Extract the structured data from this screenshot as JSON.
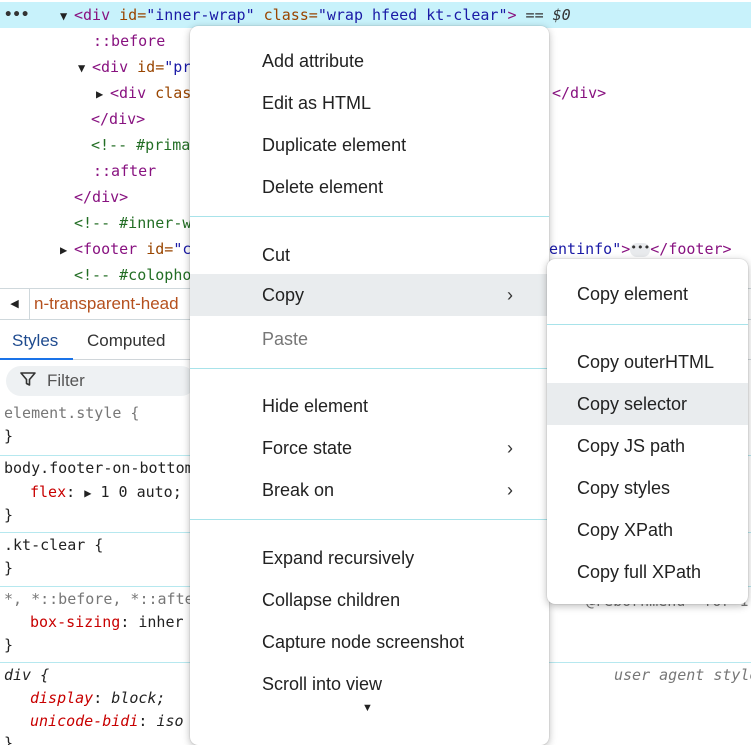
{
  "dom_tree": {
    "overflow_dots": "•••",
    "lines": [
      {
        "tri": "▼",
        "open": "<div",
        "attr1": " id=",
        "val1": "\"inner-wrap\"",
        "attr2": " class=",
        "val2": "\"wrap hfeed kt-clear\"",
        "close": ">",
        "eq": " == $0"
      },
      {
        "pseudo": "::before"
      },
      {
        "tri": "▼",
        "open": "<div",
        "attr1": " id=",
        "val1": "\"pr"
      },
      {
        "tri": "▶",
        "open": "<div",
        "attr1": " clas",
        "tail": "</div>"
      },
      {
        "tag": "</div>"
      },
      {
        "comment": "<!-- #prima"
      },
      {
        "pseudo": "::after"
      },
      {
        "tag": "</div>"
      },
      {
        "comment": "<!-- #inner-w"
      },
      {
        "tri": "▶",
        "open": "<footer",
        "attr1": " id=",
        "val1": "\"c",
        "tail_val": "entinfo\"",
        "tail_close": ">",
        "pill": "•••",
        "tail_tag": "</footer>"
      },
      {
        "comment": "<!-- #colopho"
      }
    ]
  },
  "breadcrumb": {
    "left_arrow": "◀",
    "text": "n-transparent-head"
  },
  "styles_pane": {
    "tabs": [
      {
        "label": "Styles"
      },
      {
        "label": "Computed"
      }
    ],
    "filter_placeholder": "Filter",
    "rules": {
      "element_style": "element.style {",
      "close1": "}",
      "body_selector": "body.footer-on-bottom",
      "flex_prop": "flex",
      "flex_val": "1 0 auto;",
      "close2": "}",
      "kt_clear": ".kt-clear {",
      "close3": "}",
      "universal": "*, *::before, *::afte",
      "box_sizing_prop": "box-sizing",
      "box_sizing_val": "inher",
      "close4": "}",
      "div_selector": "div {",
      "ua_note": "user agent style",
      "display_prop": "display",
      "display_val": "block;",
      "unicode_prop": "unicode-bidi",
      "unicode_val": "iso",
      "close5": "}",
      "snippet_behind_submenu": "@rebornmenu- for 1"
    }
  },
  "context_menu": {
    "items": [
      {
        "label": "Add attribute"
      },
      {
        "label": "Edit as HTML"
      },
      {
        "label": "Duplicate element"
      },
      {
        "label": "Delete element"
      },
      {
        "label": "Cut"
      },
      {
        "label": "Copy",
        "submenu": true,
        "highlighted": true
      },
      {
        "label": "Paste",
        "disabled": true
      },
      {
        "label": "Hide element"
      },
      {
        "label": "Force state",
        "submenu": true
      },
      {
        "label": "Break on",
        "submenu": true
      },
      {
        "label": "Expand recursively"
      },
      {
        "label": "Collapse children"
      },
      {
        "label": "Capture node screenshot"
      },
      {
        "label": "Scroll into view"
      }
    ],
    "submenu_arrow": "›",
    "more_indicator": "▼"
  },
  "copy_submenu": {
    "items": [
      {
        "label": "Copy element"
      },
      {
        "label": "Copy outerHTML"
      },
      {
        "label": "Copy selector",
        "highlighted": true
      },
      {
        "label": "Copy JS path"
      },
      {
        "label": "Copy styles"
      },
      {
        "label": "Copy XPath"
      },
      {
        "label": "Copy full XPath"
      }
    ]
  },
  "colors": {
    "selected_row": "#c8f2fb",
    "tag": "#881280",
    "attribute": "#994500",
    "value": "#1a1aa6",
    "comment": "#236e25",
    "property": "#c80000",
    "separator": "#a8e3ea"
  }
}
